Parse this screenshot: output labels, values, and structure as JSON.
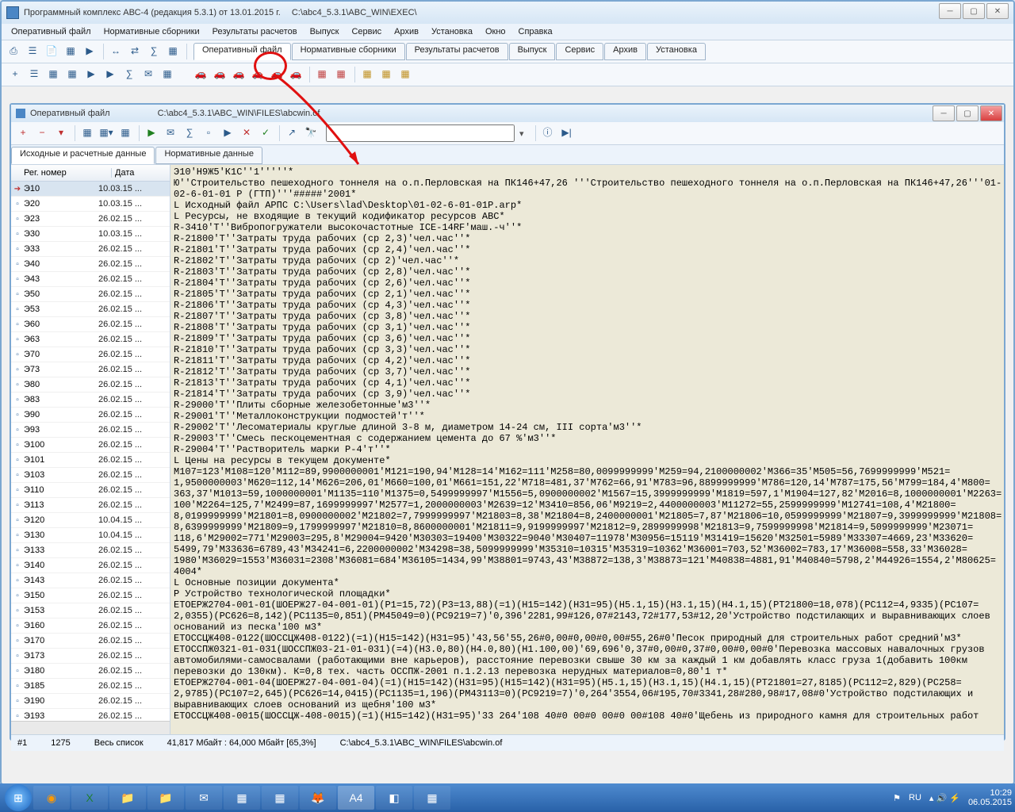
{
  "outer": {
    "title_left": "Программный комплекс АВС-4 (редакция 5.3.1) от 13.01.2015 г.",
    "title_right": "C:\\abc4_5.3.1\\ABC_WIN\\EXEC\\",
    "menu": [
      "Оперативный файл",
      "Нормативные сборники",
      "Результаты расчетов",
      "Выпуск",
      "Сервис",
      "Архив",
      "Установка",
      "Окно",
      "Справка"
    ],
    "tabs": [
      "Оперативный файл",
      "Нормативные сборники",
      "Результаты расчетов",
      "Выпуск",
      "Сервис",
      "Архив",
      "Установка"
    ]
  },
  "inner": {
    "title_left": "Оперативный файл",
    "title_right": "C:\\abc4_5.3.1\\ABC_WIN\\FILES\\abcwin.of",
    "tabs": [
      "Исходные и расчетные данные",
      "Нормативные данные"
    ],
    "col1": "Рег. номер",
    "col2": "Дата",
    "rows": [
      {
        "rn": "Э10",
        "dt": "10.03.15 ...",
        "sel": true,
        "arrow": true
      },
      {
        "rn": "Э20",
        "dt": "10.03.15 ..."
      },
      {
        "rn": "Э23",
        "dt": "26.02.15 ..."
      },
      {
        "rn": "Э30",
        "dt": "10.03.15 ..."
      },
      {
        "rn": "Э33",
        "dt": "26.02.15 ..."
      },
      {
        "rn": "Э40",
        "dt": "26.02.15 ..."
      },
      {
        "rn": "Э43",
        "dt": "26.02.15 ..."
      },
      {
        "rn": "Э50",
        "dt": "26.02.15 ..."
      },
      {
        "rn": "Э53",
        "dt": "26.02.15 ..."
      },
      {
        "rn": "Э60",
        "dt": "26.02.15 ..."
      },
      {
        "rn": "Э63",
        "dt": "26.02.15 ..."
      },
      {
        "rn": "Э70",
        "dt": "26.02.15 ..."
      },
      {
        "rn": "Э73",
        "dt": "26.02.15 ..."
      },
      {
        "rn": "Э80",
        "dt": "26.02.15 ..."
      },
      {
        "rn": "Э83",
        "dt": "26.02.15 ..."
      },
      {
        "rn": "Э90",
        "dt": "26.02.15 ..."
      },
      {
        "rn": "Э93",
        "dt": "26.02.15 ..."
      },
      {
        "rn": "Э100",
        "dt": "26.02.15 ..."
      },
      {
        "rn": "Э101",
        "dt": "26.02.15 ..."
      },
      {
        "rn": "Э103",
        "dt": "26.02.15 ..."
      },
      {
        "rn": "Э110",
        "dt": "26.02.15 ..."
      },
      {
        "rn": "Э113",
        "dt": "26.02.15 ..."
      },
      {
        "rn": "Э120",
        "dt": "10.04.15 ..."
      },
      {
        "rn": "Э130",
        "dt": "10.04.15 ..."
      },
      {
        "rn": "Э133",
        "dt": "26.02.15 ..."
      },
      {
        "rn": "Э140",
        "dt": "26.02.15 ..."
      },
      {
        "rn": "Э143",
        "dt": "26.02.15 ..."
      },
      {
        "rn": "Э150",
        "dt": "26.02.15 ..."
      },
      {
        "rn": "Э153",
        "dt": "26.02.15 ..."
      },
      {
        "rn": "Э160",
        "dt": "26.02.15 ..."
      },
      {
        "rn": "Э170",
        "dt": "26.02.15 ..."
      },
      {
        "rn": "Э173",
        "dt": "26.02.15 ..."
      },
      {
        "rn": "Э180",
        "dt": "26.02.15 ..."
      },
      {
        "rn": "Э185",
        "dt": "26.02.15 ..."
      },
      {
        "rn": "Э190",
        "dt": "26.02.15 ..."
      },
      {
        "rn": "Э193",
        "dt": "26.02.15 ..."
      }
    ],
    "text_lines": [
      "Э10'Н9Ж5'К1С''1'''''*",
      "Ю''Строительство пешеходного тоннеля на о.п.Перловская на ПК146+47,26 '''Строительство пешеходного тоннеля на о.п.Перловская на ПК146+47,26'''01-",
      "02-6-01-01 Р (ГТП)'''#####'2001*",
      "L Исходный файл АРПС C:\\Users\\lad\\Desktop\\01-02-6-01-01P.arp*",
      "L Ресурсы, не входящие в текущий кодификатор ресурсов АВС*",
      "R-3410'Т''Вибропогружатели высокочастотные ICE-14RF'маш.-ч''*",
      "R-21800'Т''Затраты труда рабочих (ср 2,3)'чел.час''*",
      "R-21801'Т''Затраты труда рабочих (ср 2,4)'чел.час''*",
      "R-21802'Т''Затраты труда рабочих (ср 2)'чел.час''*",
      "R-21803'Т''Затраты труда рабочих (ср 2,8)'чел.час''*",
      "R-21804'Т''Затраты труда рабочих (ср 2,6)'чел.час''*",
      "R-21805'Т''Затраты труда рабочих (ср 2,1)'чел.час''*",
      "R-21806'Т''Затраты труда рабочих (ср 4,3)'чел.час''*",
      "R-21807'Т''Затраты труда рабочих (ср 3,8)'чел.час''*",
      "R-21808'Т''Затраты труда рабочих (ср 3,1)'чел.час''*",
      "R-21809'Т''Затраты труда рабочих (ср 3,6)'чел.час''*",
      "R-21810'Т''Затраты труда рабочих (ср 3,3)'чел.час''*",
      "R-21811'Т''Затраты труда рабочих (ср 4,2)'чел.час''*",
      "R-21812'Т''Затраты труда рабочих (ср 3,7)'чел.час''*",
      "R-21813'Т''Затраты труда рабочих (ср 4,1)'чел.час''*",
      "R-21814'Т''Затраты труда рабочих (ср 3,9)'чел.час''*",
      "R-29000'Т''Плиты сборные железобетонные'м3''*",
      "R-29001'Т''Металлоконструкции подмостей'т''*",
      "R-29002'Т''Лесоматериалы круглые длиной 3-8 м, диаметром 14-24 см, III сорта'м3''*",
      "R-29003'Т''Смесь пескоцементная с содержанием цемента до 67 %'м3''*",
      "R-29004'Т''Растворитель марки Р-4'т''*",
      "L Цены на ресурсы в текущем документе*",
      "М107=123'М108=120'М112=89,9900000001'М121=190,94'М128=14'М162=111'М258=80,0099999999'М259=94,2100000002'М366=35'М505=56,7699999999'М521=",
      "1,9500000003'М620=112,14'М626=206,01'М660=100,01'М661=151,22'М718=481,37'М762=66,91'М783=96,8899999999'М786=120,14'М787=175,56'М799=184,4'М800=",
      "363,37'М1013=59,1000000001'М1135=110'М1375=0,5499999997'М1556=5,0900000002'М1567=15,3999999999'М1819=597,1'М1904=127,82'М2016=8,1000000001'М2263=",
      "100'М2264=125,7'М2499=87,1699999997'М2577=1,2000000003'М2639=12'М3410=856,06'М9219=2,4400000003'М11272=55,2599999999'М12741=108,4'М21800=",
      "8,0199999999'М21801=8,0900000002'М21802=7,7999999997'М21803=8,38'М21804=8,2400000001'М21805=7,87'М21806=10,0599999999'М21807=9,3999999999'М21808=",
      "8,6399999999'М21809=9,1799999997'М21810=8,8600000001'М21811=9,9199999997'М21812=9,2899999998'М21813=9,7599999998'М21814=9,5099999999'М23071=",
      "118,6'М29002=771'М29003=295,8'М29004=9420'М30303=19400'М30322=9040'М30407=11978'М30956=15119'М31419=15620'М32501=5989'М33307=4669,23'М33620=",
      "5499,79'М33636=6789,43'М34241=6,2200000002'М34298=38,5099999999'М35310=10315'М35319=10362'М36001=703,52'М36002=783,17'М36008=558,33'М36028=",
      "1980'М36029=1553'М36031=2308'М36081=684'М36105=1434,99'М38801=9743,43'М38872=138,3'М38873=121'М40838=4881,91'М40840=5798,2'М44926=1554,2'М80625=",
      "4004*",
      "L Основные позиции документа*",
      "Р Устройство технологической площадки*",
      "ЕТОЕРЖ2704-001-01(ШОЕРЖ27-04-001-01)(Р1=15,72)(Р3=13,88)(=1)(Н15=142)(Н31=95)(Н5.1,15)(Н3.1,15)(Н4.1,15)(РТ21800=18,078)(РС112=4,9335)(РС107=",
      "2,0355)(РС626=8,142)(РС1135=0,851)(РМ45049=0)(РС9219=7)'0,396'2281,99#126,07#2143,72#177,53#12,20'Устройство подстилающих и выравнивающих слоев",
      "оснований из песка'100 м3*",
      "ЕТОССЦЖ408-0122(ШОССЦЖ408-0122)(=1)(Н15=142)(Н31=95)'43,56'55,26#0,00#0,00#0,00#55,26#0'Песок природный для строительных работ средний'м3*",
      "ЕТОССПЖ0321-01-031(ШОССПЖ03-21-01-031)(=4)(Н3.0,80)(Н4.0,80)(Н1.100,00)'69,696'0,37#0,00#0,37#0,00#0,00#0'Перевозка массовых навалочных грузов",
      "автомобилями-самосвалами (работающими вне карьеров), расстояние перевозки свыше 30 км за каждый 1 км добавлять класс груза 1(добавить 100км",
      "перевозки до 130км). К=0,8 тех. часть ОССПЖ-2001 п.1.2.13 перевозка нерудных материалов=0,80'1 т*",
      "ЕТОЕРЖ2704-001-04(ШОЕРЖ27-04-001-04)(=1)(Н15=142)(Н31=95)(Н15=142)(Н31=95)(Н5.1,15)(Н3.1,15)(Н4.1,15)(РТ21801=27,8185)(РС112=2,829)(РС258=",
      "2,9785)(РС107=2,645)(РС626=14,0415)(РС1135=1,196)(РМ43113=0)(РС9219=7)'0,264'3554,06#195,70#3341,28#280,98#17,08#0'Устройство подстилающих и",
      "выравнивающих слоев оснований из щебня'100 м3*",
      "ЕТОССЦЖ408-0015(ШОССЦЖ-408-0015)(=1)(Н15=142)(Н31=95)'33 264'108 40#0 00#0 00#0 00#108 40#0'Щебень из природного камня для строительных работ"
    ],
    "status": {
      "s1": "#1",
      "s2": "1275",
      "s3": "Весь список",
      "s4": "41,817 Мбайт : 64,000 Мбайт  [65,3%]",
      "s5": "C:\\abc4_5.3.1\\ABC_WIN\\FILES\\abcwin.of"
    }
  },
  "taskbar": {
    "lang": "RU",
    "time": "10:29",
    "date": "06.05.2015"
  }
}
